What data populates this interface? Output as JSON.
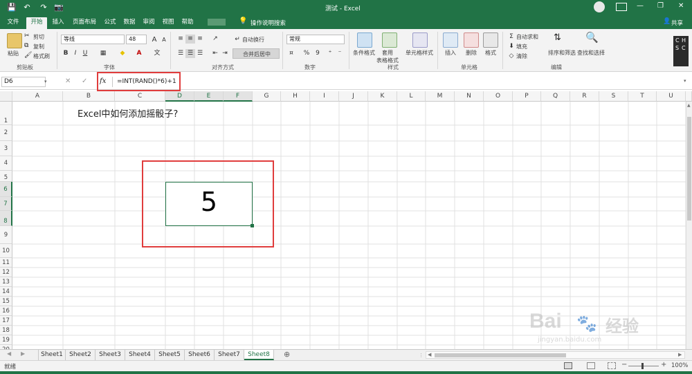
{
  "window": {
    "title": "测试 - Excel",
    "controls": {
      "minimize": "—",
      "restore": "❐",
      "close": "✕"
    }
  },
  "quick_access": {
    "save": "💾",
    "undo": "↶",
    "redo": "↷",
    "camera": "📷"
  },
  "tabs": [
    {
      "label": "文件"
    },
    {
      "label": "开始"
    },
    {
      "label": "插入"
    },
    {
      "label": "页面布局"
    },
    {
      "label": "公式"
    },
    {
      "label": "数据"
    },
    {
      "label": "审阅"
    },
    {
      "label": "视图"
    },
    {
      "label": "帮助"
    }
  ],
  "tell_me": "操作说明搜索",
  "share": "共享",
  "ribbon": {
    "clipboard": {
      "paste": "粘贴",
      "cut": "剪切",
      "copy": "复制",
      "format_painter": "格式刷",
      "group": "剪贴板"
    },
    "font": {
      "name": "等线",
      "size": "48",
      "bold": "B",
      "italic": "I",
      "underline": "U",
      "grow": "A",
      "shrink": "A",
      "group": "字体"
    },
    "alignment": {
      "wrap": "自动换行",
      "merge": "合并后居中",
      "group": "对齐方式"
    },
    "number": {
      "format": "常规",
      "percent": "%",
      "comma": "9",
      "group": "数字"
    },
    "styles": {
      "conditional": "条件格式",
      "table": "套用\n表格格式",
      "cell_styles": "单元格样式",
      "group": "样式"
    },
    "cells": {
      "insert": "插入",
      "delete": "删除",
      "format": "格式",
      "group": "单元格"
    },
    "editing": {
      "autosum": "自动求和",
      "fill": "填充",
      "clear": "清除",
      "sort": "排序和筛选",
      "find": "查找和选择",
      "group": "编辑"
    }
  },
  "ime": [
    "C",
    "H",
    "S",
    "C"
  ],
  "formula_bar": {
    "name_box": "D6",
    "fx": "fx",
    "formula": "=INT(RAND()*6)+1"
  },
  "columns": [
    "A",
    "B",
    "C",
    "D",
    "E",
    "F",
    "G",
    "H",
    "I",
    "J",
    "K",
    "L",
    "M",
    "N",
    "O",
    "P",
    "Q",
    "R",
    "S",
    "T",
    "U"
  ],
  "rows": [
    "1",
    "2",
    "3",
    "4",
    "5",
    "6",
    "7",
    "8",
    "9",
    "10",
    "11",
    "12",
    "13",
    "14",
    "15",
    "16",
    "17",
    "18",
    "19",
    "20"
  ],
  "cells": {
    "title": "Excel中如何添加摇骰子?",
    "dice_value": "5"
  },
  "sheets": [
    "Sheet1",
    "Sheet2",
    "Sheet3",
    "Sheet4",
    "Sheet5",
    "Sheet6",
    "Sheet7",
    "Sheet8"
  ],
  "active_sheet": "Sheet8",
  "status": {
    "ready": "就绪",
    "zoom": "100%"
  },
  "watermark": {
    "brand": "Bai",
    "brand_cn": "经验",
    "url": "jingyan.baidu.com"
  },
  "colors": {
    "excel_green": "#217346",
    "highlight_red": "#e03c3c"
  }
}
